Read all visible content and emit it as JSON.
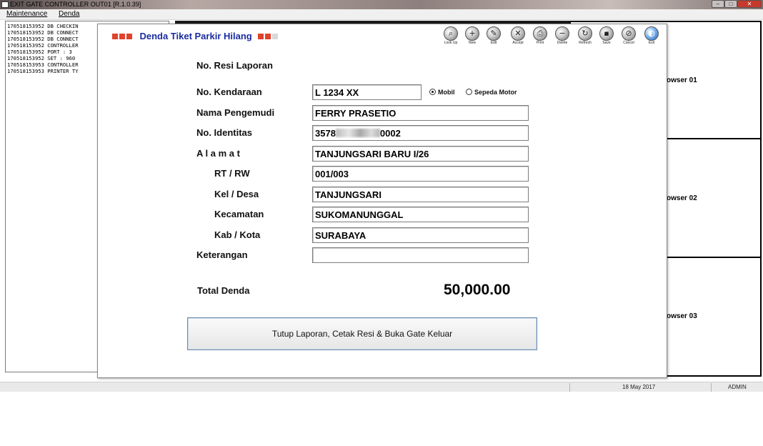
{
  "window": {
    "title": "EXIT GATE CONTROLLER OUT01 [R.1.0.39]"
  },
  "menu": [
    {
      "label": "Maintenance"
    },
    {
      "label": "Denda"
    }
  ],
  "log": [
    "170518153952 DB CHECKIN",
    "170518153952 DB CONNECT",
    "170518153952 DB CONNECT",
    "170518153952 CONTROLLER",
    "170518153952 PORT  :  3",
    "170518153952 SET  : 960",
    "170518153953 CONTROLLER",
    "170518153953 PRINTER TY"
  ],
  "browsers": [
    {
      "label": "owser 01"
    },
    {
      "label": "owser 02"
    },
    {
      "label": "owser 03"
    }
  ],
  "status": {
    "date": "18 May 2017",
    "user": "ADMIN"
  },
  "dialog": {
    "title": "Denda Tiket Parkir Hilang",
    "toolbar": [
      {
        "label": "Look Up",
        "icon": "lookup-icon"
      },
      {
        "label": "New",
        "icon": "new-icon"
      },
      {
        "label": "Edit",
        "icon": "edit-icon"
      },
      {
        "label": "Accept",
        "icon": "accept-icon"
      },
      {
        "label": "Print",
        "icon": "print-icon"
      },
      {
        "label": "Delete",
        "icon": "delete-icon"
      },
      {
        "label": "Refresh",
        "icon": "refresh-icon"
      },
      {
        "label": "Save",
        "icon": "save-icon"
      },
      {
        "label": "Cancel",
        "icon": "cancel-icon"
      },
      {
        "label": "Exit",
        "icon": "exit-icon"
      }
    ],
    "form": {
      "resi_label": "No. Resi Laporan",
      "kendaraan_label": "No. Kendaraan",
      "kendaraan_value": "L 1234 XX",
      "radio_mobil": "Mobil",
      "radio_motor": "Sepeda Motor",
      "vehicle_type_selected": "Mobil",
      "pengemudi_label": "Nama Pengemudi",
      "pengemudi_value": "FERRY PRASETIO",
      "identitas_label": "No. Identitas",
      "identitas_prefix": "3578",
      "identitas_suffix": "0002",
      "alamat_label": "A l a m a t",
      "alamat_value": "TANJUNGSARI BARU I/26",
      "rtrw_label": "RT / RW",
      "rtrw_value": "001/003",
      "kel_label": "Kel / Desa",
      "kel_value": "TANJUNGSARI",
      "kec_label": "Kecamatan",
      "kec_value": "SUKOMANUNGGAL",
      "kab_label": "Kab / Kota",
      "kab_value": "SURABAYA",
      "ket_label": "Keterangan",
      "ket_value": ""
    },
    "total_label": "Total Denda",
    "total_value": "50,000.00",
    "submit_label": "Tutup Laporan, Cetak Resi & Buka Gate Keluar"
  }
}
